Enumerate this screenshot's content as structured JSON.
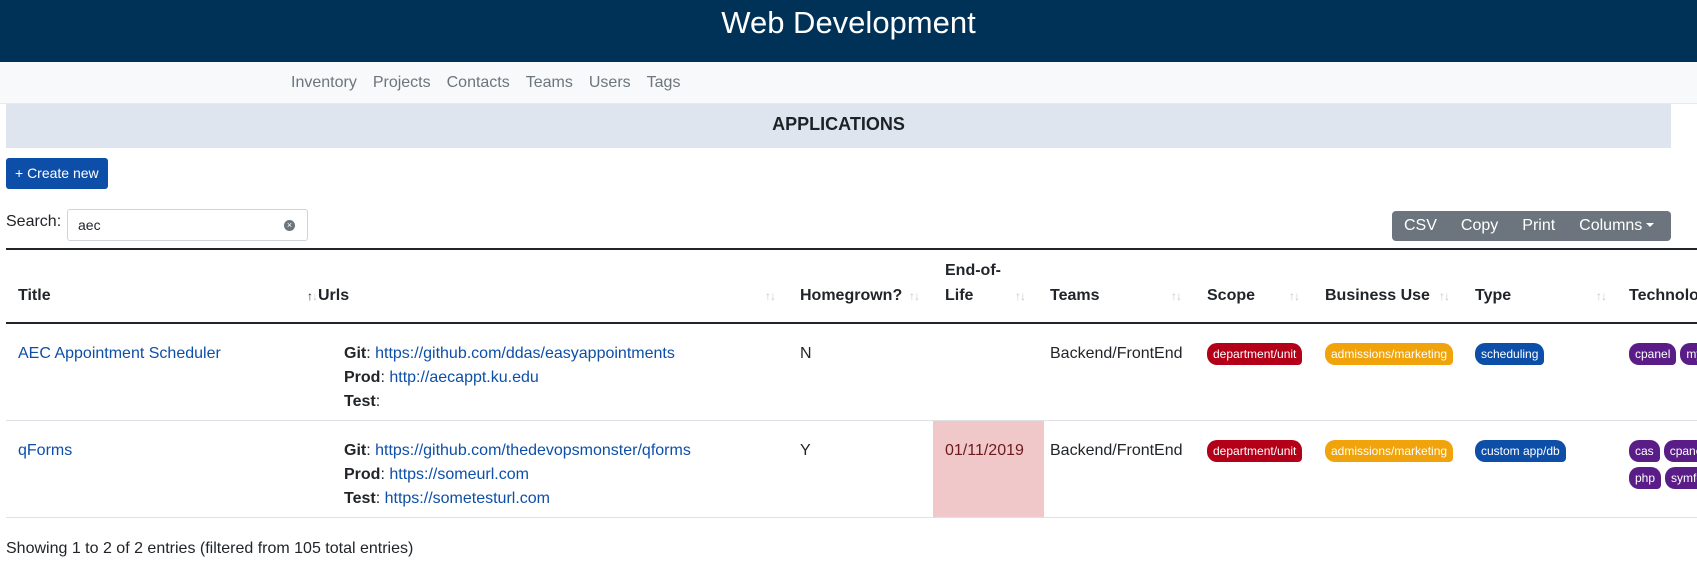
{
  "header": {
    "site_title": "Web Development"
  },
  "nav": {
    "items": [
      "Inventory",
      "Projects",
      "Contacts",
      "Teams",
      "Users",
      "Tags"
    ]
  },
  "section": {
    "title": "APPLICATIONS"
  },
  "toolbar": {
    "create_label": "+ Create new",
    "search_label": "Search:",
    "search_value": "aec",
    "buttons": {
      "csv": "CSV",
      "copy": "Copy",
      "print": "Print",
      "columns": "Columns"
    }
  },
  "table": {
    "headers": {
      "title": "Title",
      "urls": "Urls",
      "homegrown": "Homegrown?",
      "eol_1": "End-of-",
      "eol_2": "Life",
      "teams": "Teams",
      "scope": "Scope",
      "business": "Business Use",
      "type": "Type",
      "tech": "Technolo"
    },
    "url_labels": {
      "git": "Git",
      "prod": "Prod",
      "test": "Test"
    },
    "rows": [
      {
        "title": "AEC Appointment Scheduler",
        "git": "https://github.com/ddas/easyappointments",
        "prod": "http://aecappt.ku.edu",
        "test": "",
        "homegrown": "N",
        "eol": "",
        "teams": "Backend/FrontEnd",
        "scope": "department/unit",
        "business": "admissions/marketing",
        "type": "scheduling",
        "tech": [
          "cpanel",
          "my"
        ]
      },
      {
        "title": "qForms",
        "git": "https://github.com/thedevopsmonster/qforms",
        "prod": "https://someurl.com",
        "test": "https://sometesturl.com",
        "homegrown": "Y",
        "eol": "01/11/2019",
        "teams": "Backend/FrontEnd",
        "scope": "department/unit",
        "business": "admissions/marketing",
        "type": "custom app/db",
        "tech": [
          "cas",
          "cpane",
          "php",
          "symfo"
        ]
      }
    ]
  },
  "footer": {
    "info": "Showing 1 to 2 of 2 entries (filtered from 105 total entries)"
  },
  "colors": {
    "header_bg": "#003258",
    "primary": "#0d4fa8",
    "scope_badge": "#b30018",
    "business_badge": "#f0a30a",
    "type_badge": "#0d4fa8",
    "tech_badge": "#5a1d88",
    "eol_highlight": "#f0c8ca"
  }
}
